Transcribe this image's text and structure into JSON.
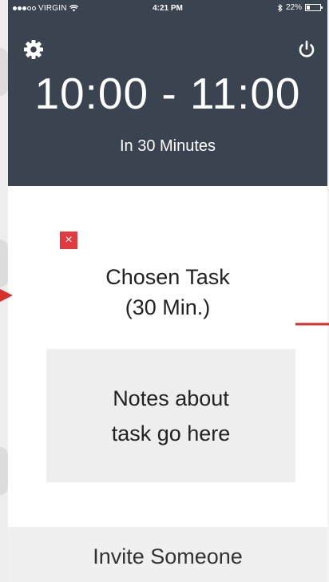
{
  "status_bar": {
    "carrier": "VIRGIN",
    "time": "4:21 PM",
    "battery": "22%",
    "battery_level": 0.22
  },
  "header": {
    "time_range": "10:00 - 11:00",
    "countdown": "In 30 Minutes",
    "settings_icon": "gear-icon",
    "power_icon": "power-icon"
  },
  "task": {
    "delete_icon": "close-icon",
    "delete_glyph": "×",
    "title_line1": "Chosen Task",
    "title_line2": "(30 Min.)",
    "notes_line1": "Notes about",
    "notes_line2": "task go here"
  },
  "footer": {
    "invite_label": "Invite Someone"
  },
  "colors": {
    "header_bg": "#3a4350",
    "delete_red": "#e33a41",
    "annotation_arrow": "#d9302c",
    "notes_bg": "#eeeeee",
    "footer_bg": "#f0f0f0"
  }
}
